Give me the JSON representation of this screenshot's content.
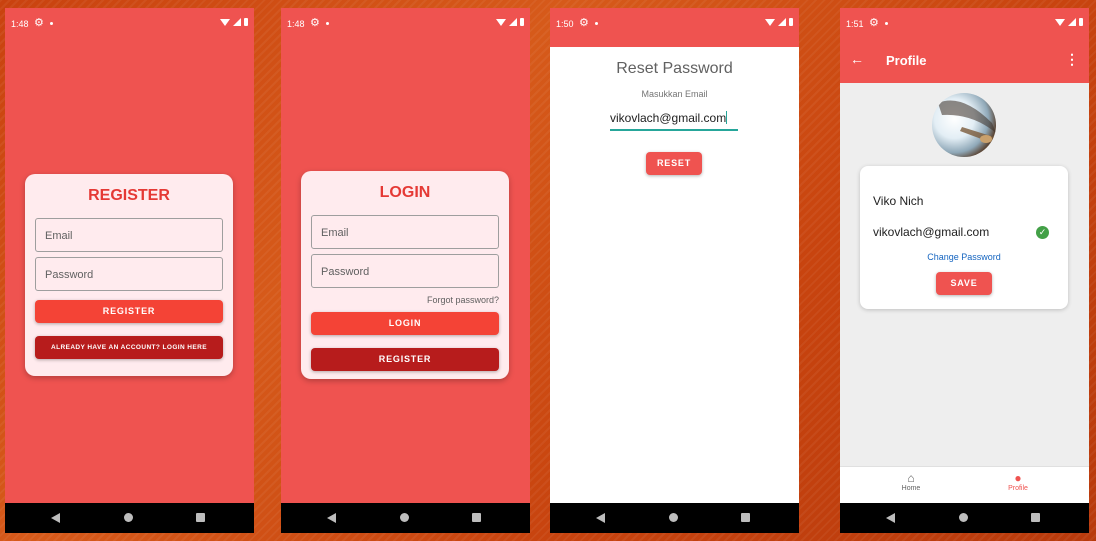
{
  "phones": [
    {
      "status_time": "1:48",
      "card_title": "REGISTER",
      "email_placeholder": "Email",
      "password_placeholder": "Password",
      "primary_button": "REGISTER",
      "secondary_button": "ALREADY HAVE AN ACCOUNT? LOGIN HERE"
    },
    {
      "status_time": "1:48",
      "card_title": "LOGIN",
      "email_placeholder": "Email",
      "password_placeholder": "Password",
      "forgot_link": "Forgot password?",
      "primary_button": "LOGIN",
      "secondary_button": "REGISTER"
    },
    {
      "status_time": "1:50",
      "title": "Reset Password",
      "label": "Masukkan Email",
      "email_value": "vikovlach@gmail.com",
      "button": "RESET"
    },
    {
      "status_time": "1:51",
      "app_title": "Profile",
      "name": "Viko Nich",
      "email": "vikovlach@gmail.com",
      "change_password": "Change Password",
      "save_button": "SAVE",
      "nav": [
        {
          "label": "Home",
          "icon": "home-icon",
          "active": false
        },
        {
          "label": "Profile",
          "icon": "person-icon",
          "active": true
        }
      ]
    }
  ],
  "colors": {
    "primary": "#ef5350",
    "button_red": "#f44336",
    "button_dark": "#b71c1c",
    "card_bg": "#ffebee",
    "link_blue": "#1565c0",
    "verified_green": "#43a047",
    "input_underline": "#26a69a"
  }
}
